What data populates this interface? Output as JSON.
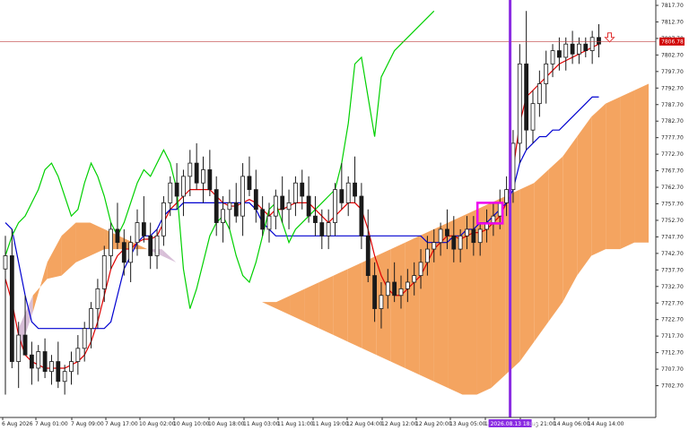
{
  "chart_data": {
    "type": "candlestick",
    "y_axis": {
      "min": 7697.7,
      "max": 7817.7,
      "tick_labels": [
        "7817.70",
        "7812.70",
        "7807.70",
        "7802.70",
        "7797.70",
        "7792.70",
        "7787.70",
        "7782.70",
        "7777.70",
        "7772.70",
        "7767.70",
        "7762.70",
        "7757.70",
        "7752.70",
        "7747.70",
        "7742.70",
        "7737.70",
        "7732.70",
        "7727.70",
        "7722.70",
        "7717.70",
        "7712.70",
        "7707.70",
        "7702.70"
      ]
    },
    "x_axis": {
      "tick_labels": [
        "6 Aug 2026",
        "7 Aug 01:00",
        "7 Aug 09:00",
        "7 Aug 17:00",
        "10 Aug 02:00",
        "10 Aug 10:00",
        "10 Aug 18:00",
        "11 Aug 03:00",
        "11 Aug 11:00",
        "11 Aug 19:00",
        "12 Aug 04:00",
        "12 Aug 12:00",
        "12 Aug 20:00",
        "13 Aug 05:00",
        "13 Aug 13:00",
        "13 Aug 21:00",
        "14 Aug 06:00",
        "14 Aug 14:00"
      ],
      "highlighted_label": "2026.08.13 18:00"
    },
    "current_price": "7806.78",
    "grid": false,
    "candles": [
      [
        7738,
        7748,
        7700,
        7742
      ],
      [
        7742,
        7750,
        7708,
        7710
      ],
      [
        7710,
        7722,
        7702,
        7718
      ],
      [
        7718,
        7730,
        7712,
        7712
      ],
      [
        7712,
        7716,
        7703,
        7708
      ],
      [
        7708,
        7715,
        7704,
        7713
      ],
      [
        7713,
        7717,
        7705,
        7707
      ],
      [
        7707,
        7712,
        7703,
        7710
      ],
      [
        7710,
        7716,
        7702,
        7704
      ],
      [
        7704,
        7709,
        7700,
        7707
      ],
      [
        7707,
        7713,
        7703,
        7710
      ],
      [
        7710,
        7718,
        7706,
        7714
      ],
      [
        7714,
        7722,
        7710,
        7720
      ],
      [
        7720,
        7728,
        7714,
        7726
      ],
      [
        7726,
        7735,
        7720,
        7732
      ],
      [
        7732,
        7745,
        7728,
        7742
      ],
      [
        7742,
        7752,
        7738,
        7750
      ],
      [
        7750,
        7758,
        7744,
        7746
      ],
      [
        7746,
        7750,
        7736,
        7740
      ],
      [
        7740,
        7748,
        7734,
        7746
      ],
      [
        7746,
        7756,
        7742,
        7752
      ],
      [
        7752,
        7760,
        7746,
        7748
      ],
      [
        7748,
        7752,
        7738,
        7742
      ],
      [
        7742,
        7750,
        7738,
        7748
      ],
      [
        7748,
        7760,
        7745,
        7758
      ],
      [
        7758,
        7766,
        7754,
        7764
      ],
      [
        7764,
        7770,
        7756,
        7760
      ],
      [
        7760,
        7768,
        7754,
        7766
      ],
      [
        7766,
        7774,
        7760,
        7770
      ],
      [
        7770,
        7776,
        7762,
        7764
      ],
      [
        7764,
        7772,
        7758,
        7768
      ],
      [
        7768,
        7774,
        7760,
        7762
      ],
      [
        7762,
        7766,
        7748,
        7752
      ],
      [
        7752,
        7760,
        7746,
        7756
      ],
      [
        7756,
        7762,
        7750,
        7758
      ],
      [
        7758,
        7764,
        7752,
        7754
      ],
      [
        7754,
        7770,
        7748,
        7766
      ],
      [
        7766,
        7772,
        7760,
        7762
      ],
      [
        7762,
        7768,
        7752,
        7756
      ],
      [
        7756,
        7760,
        7748,
        7750
      ],
      [
        7750,
        7758,
        7746,
        7754
      ],
      [
        7754,
        7762,
        7750,
        7760
      ],
      [
        7760,
        7766,
        7752,
        7756
      ],
      [
        7756,
        7762,
        7750,
        7758
      ],
      [
        7758,
        7766,
        7754,
        7764
      ],
      [
        7764,
        7768,
        7756,
        7760
      ],
      [
        7760,
        7766,
        7752,
        7754
      ],
      [
        7754,
        7760,
        7748,
        7752
      ],
      [
        7752,
        7756,
        7744,
        7748
      ],
      [
        7748,
        7756,
        7744,
        7752
      ],
      [
        7752,
        7764,
        7748,
        7762
      ],
      [
        7762,
        7770,
        7756,
        7758
      ],
      [
        7758,
        7766,
        7754,
        7764
      ],
      [
        7764,
        7772,
        7758,
        7760
      ],
      [
        7760,
        7764,
        7744,
        7748
      ],
      [
        7748,
        7756,
        7734,
        7736
      ],
      [
        7736,
        7740,
        7722,
        7726
      ],
      [
        7726,
        7734,
        7720,
        7730
      ],
      [
        7730,
        7738,
        7726,
        7734
      ],
      [
        7734,
        7740,
        7728,
        7730
      ],
      [
        7730,
        7736,
        7726,
        7732
      ],
      [
        7732,
        7738,
        7728,
        7734
      ],
      [
        7734,
        7740,
        7730,
        7736
      ],
      [
        7736,
        7744,
        7732,
        7740
      ],
      [
        7740,
        7748,
        7736,
        7744
      ],
      [
        7744,
        7750,
        7740,
        7746
      ],
      [
        7746,
        7752,
        7742,
        7750
      ],
      [
        7750,
        7756,
        7744,
        7748
      ],
      [
        7748,
        7754,
        7740,
        7744
      ],
      [
        7744,
        7750,
        7740,
        7748
      ],
      [
        7748,
        7754,
        7744,
        7750
      ],
      [
        7750,
        7754,
        7742,
        7746
      ],
      [
        7746,
        7752,
        7742,
        7750
      ],
      [
        7750,
        7756,
        7746,
        7752
      ],
      [
        7752,
        7758,
        7748,
        7754
      ],
      [
        7754,
        7762,
        7750,
        7758
      ],
      [
        7758,
        7766,
        7754,
        7762
      ],
      [
        7762,
        7780,
        7758,
        7776
      ],
      [
        7776,
        7806,
        7770,
        7800
      ],
      [
        7800,
        7816,
        7774,
        7780
      ],
      [
        7780,
        7792,
        7776,
        7788
      ],
      [
        7788,
        7798,
        7784,
        7794
      ],
      [
        7794,
        7804,
        7788,
        7800
      ],
      [
        7800,
        7806,
        7796,
        7804
      ],
      [
        7804,
        7808,
        7798,
        7802
      ],
      [
        7802,
        7808,
        7798,
        7806
      ],
      [
        7806,
        7810,
        7800,
        7803
      ],
      [
        7803,
        7808,
        7800,
        7806
      ],
      [
        7806,
        7808,
        7802,
        7804
      ],
      [
        7804,
        7810,
        7800,
        7808
      ],
      [
        7808,
        7812,
        7802,
        7806
      ]
    ],
    "series": [
      {
        "kind": "tenkan",
        "color": "#e00000",
        "values": [
          7735,
          7728,
          7718,
          7712,
          7710,
          7709,
          7708,
          7708,
          7708,
          7708,
          7709,
          7710,
          7712,
          7716,
          7722,
          7730,
          7738,
          7742,
          7744,
          7744,
          7746,
          7747,
          7747,
          7748,
          7752,
          7756,
          7758,
          7760,
          7762,
          7762,
          7762,
          7762,
          7760,
          7758,
          7757,
          7757,
          7758,
          7759,
          7758,
          7756,
          7754,
          7756,
          7756,
          7757,
          7758,
          7758,
          7758,
          7756,
          7754,
          7752,
          7754,
          7756,
          7758,
          7758,
          7756,
          7750,
          7742,
          7736,
          7732,
          7730,
          7730,
          7732,
          7734,
          7736,
          7740,
          7744,
          7746,
          7748,
          7748,
          7747,
          7748,
          7749,
          7749,
          7750,
          7752,
          7754,
          7758,
          7768,
          7782,
          7790,
          7792,
          7794,
          7796,
          7798,
          7800,
          7801,
          7802,
          7803,
          7804,
          7805,
          7806
        ]
      },
      {
        "kind": "kijun",
        "color": "#0000d0",
        "values": [
          7752,
          7750,
          7740,
          7730,
          7722,
          7720,
          7720,
          7720,
          7720,
          7720,
          7720,
          7720,
          7720,
          7720,
          7720,
          7720,
          7722,
          7730,
          7738,
          7742,
          7746,
          7748,
          7748,
          7750,
          7754,
          7756,
          7756,
          7758,
          7758,
          7758,
          7758,
          7758,
          7758,
          7758,
          7758,
          7758,
          7758,
          7758,
          7756,
          7752,
          7750,
          7748,
          7748,
          7748,
          7748,
          7748,
          7748,
          7748,
          7748,
          7748,
          7748,
          7748,
          7748,
          7748,
          7748,
          7748,
          7748,
          7748,
          7748,
          7748,
          7748,
          7748,
          7748,
          7748,
          7746,
          7746,
          7746,
          7746,
          7748,
          7748,
          7750,
          7750,
          7752,
          7752,
          7754,
          7756,
          7758,
          7762,
          7770,
          7774,
          7776,
          7778,
          7778,
          7780,
          7780,
          7782,
          7784,
          7786,
          7788,
          7790,
          7790
        ]
      },
      {
        "kind": "chikou",
        "color": "#00d000",
        "values": [
          7742,
          7748,
          7752,
          7754,
          7758,
          7762,
          7768,
          7770,
          7766,
          7760,
          7754,
          7756,
          7764,
          7770,
          7766,
          7760,
          7752,
          7748,
          7752,
          7758,
          7764,
          7768,
          7766,
          7770,
          7774,
          7770,
          7762,
          7738,
          7726,
          7732,
          7740,
          7748,
          7752,
          7754,
          7750,
          7742,
          7736,
          7734,
          7740,
          7748,
          7756,
          7758,
          7752,
          7746,
          7750,
          7752,
          7754,
          7756,
          7758,
          7760,
          7762,
          7770,
          7782,
          7800,
          7802,
          7790,
          7778,
          7796,
          7800,
          7804,
          7806,
          7808,
          7810,
          7812,
          7814,
          7816
        ]
      },
      {
        "kind": "span_a",
        "color": "#f4a460",
        "values": [
          7712,
          7725,
          7740,
          7748,
          7752,
          7752,
          7750,
          7748,
          7746,
          7744,
          7742,
          7740,
          7738,
          7736,
          7734,
          7732,
          7730,
          7728,
          7728,
          7730,
          7732,
          7734,
          7736,
          7738,
          7740,
          7742,
          7744,
          7746,
          7748,
          7750,
          7752,
          7754,
          7756,
          7758,
          7760,
          7762,
          7764,
          7768,
          7772,
          7778,
          7784,
          7788,
          7790,
          7792,
          7794
        ]
      },
      {
        "kind": "span_b",
        "color": "#d8bfd8",
        "values": [
          7720,
          7730,
          7735,
          7736,
          7740,
          7742,
          7744,
          7744,
          7744,
          7744,
          7744,
          7740,
          7738,
          7736,
          7734,
          7732,
          7730,
          7728,
          7726,
          7724,
          7722,
          7720,
          7718,
          7716,
          7714,
          7712,
          7710,
          7708,
          7706,
          7704,
          7702,
          7700,
          7700,
          7702,
          7706,
          7710,
          7716,
          7722,
          7728,
          7736,
          7742,
          7744,
          7744,
          7746,
          7746
        ]
      }
    ]
  },
  "colors": {
    "up_candle": "#ffffff",
    "down_candle": "#1a1a1a",
    "cloud_bull": "#f4a460",
    "cloud_bear": "#d8bfd8",
    "time_marker": "#8a2be2",
    "highlight_box": "#ee00ee",
    "price_line": "#c04040",
    "price_tag_bg": "#d00000"
  },
  "icons": {
    "arrow": "down-arrow-icon"
  }
}
